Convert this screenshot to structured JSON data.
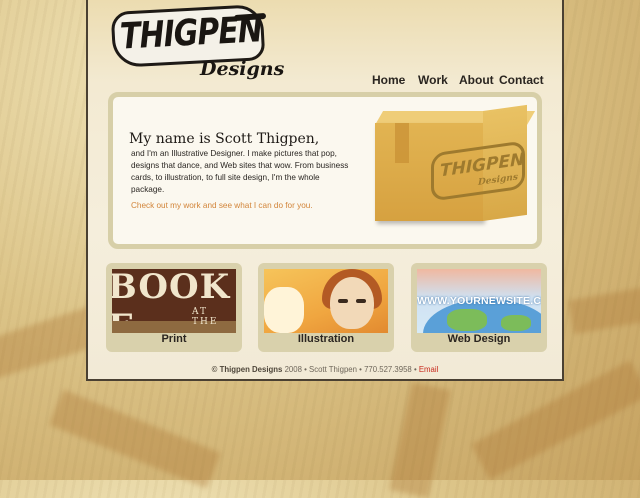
{
  "brand": {
    "logo_main": "THIGPEN",
    "logo_sub": "Designs"
  },
  "nav": {
    "items": [
      {
        "label": "Home"
      },
      {
        "label": "Work"
      },
      {
        "label": "About"
      },
      {
        "label": "Contact"
      }
    ]
  },
  "hero": {
    "title": "My name is Scott Thigpen,",
    "body": "and I'm an Illustrative Designer. I make pictures that pop, designs that dance, and Web sites that wow. From business cards, to illustration, to full site design, I'm the whole package.",
    "cta": "Check out my work and see what I can do for you.",
    "box_logo_main": "THIGPEN",
    "box_logo_sub": "Designs"
  },
  "tiles": [
    {
      "label": "Print",
      "image_text_main": "BOOK E",
      "image_text_sub": "AT THE"
    },
    {
      "label": "Illustration"
    },
    {
      "label": "Web Design",
      "image_text": "WWW.YOURNEWSITE.CO"
    }
  ],
  "footer": {
    "copyright": "© Thigpen Designs",
    "year": "2008",
    "name": "Scott Thigpen",
    "phone": "770.527.3958",
    "sep": "•",
    "email_label": "Email"
  },
  "colors": {
    "background": "#dcc488",
    "page": "#f5eedc",
    "panel_border": "#d7cfa8",
    "link": "#d2853a",
    "email": "#c82a1e"
  }
}
